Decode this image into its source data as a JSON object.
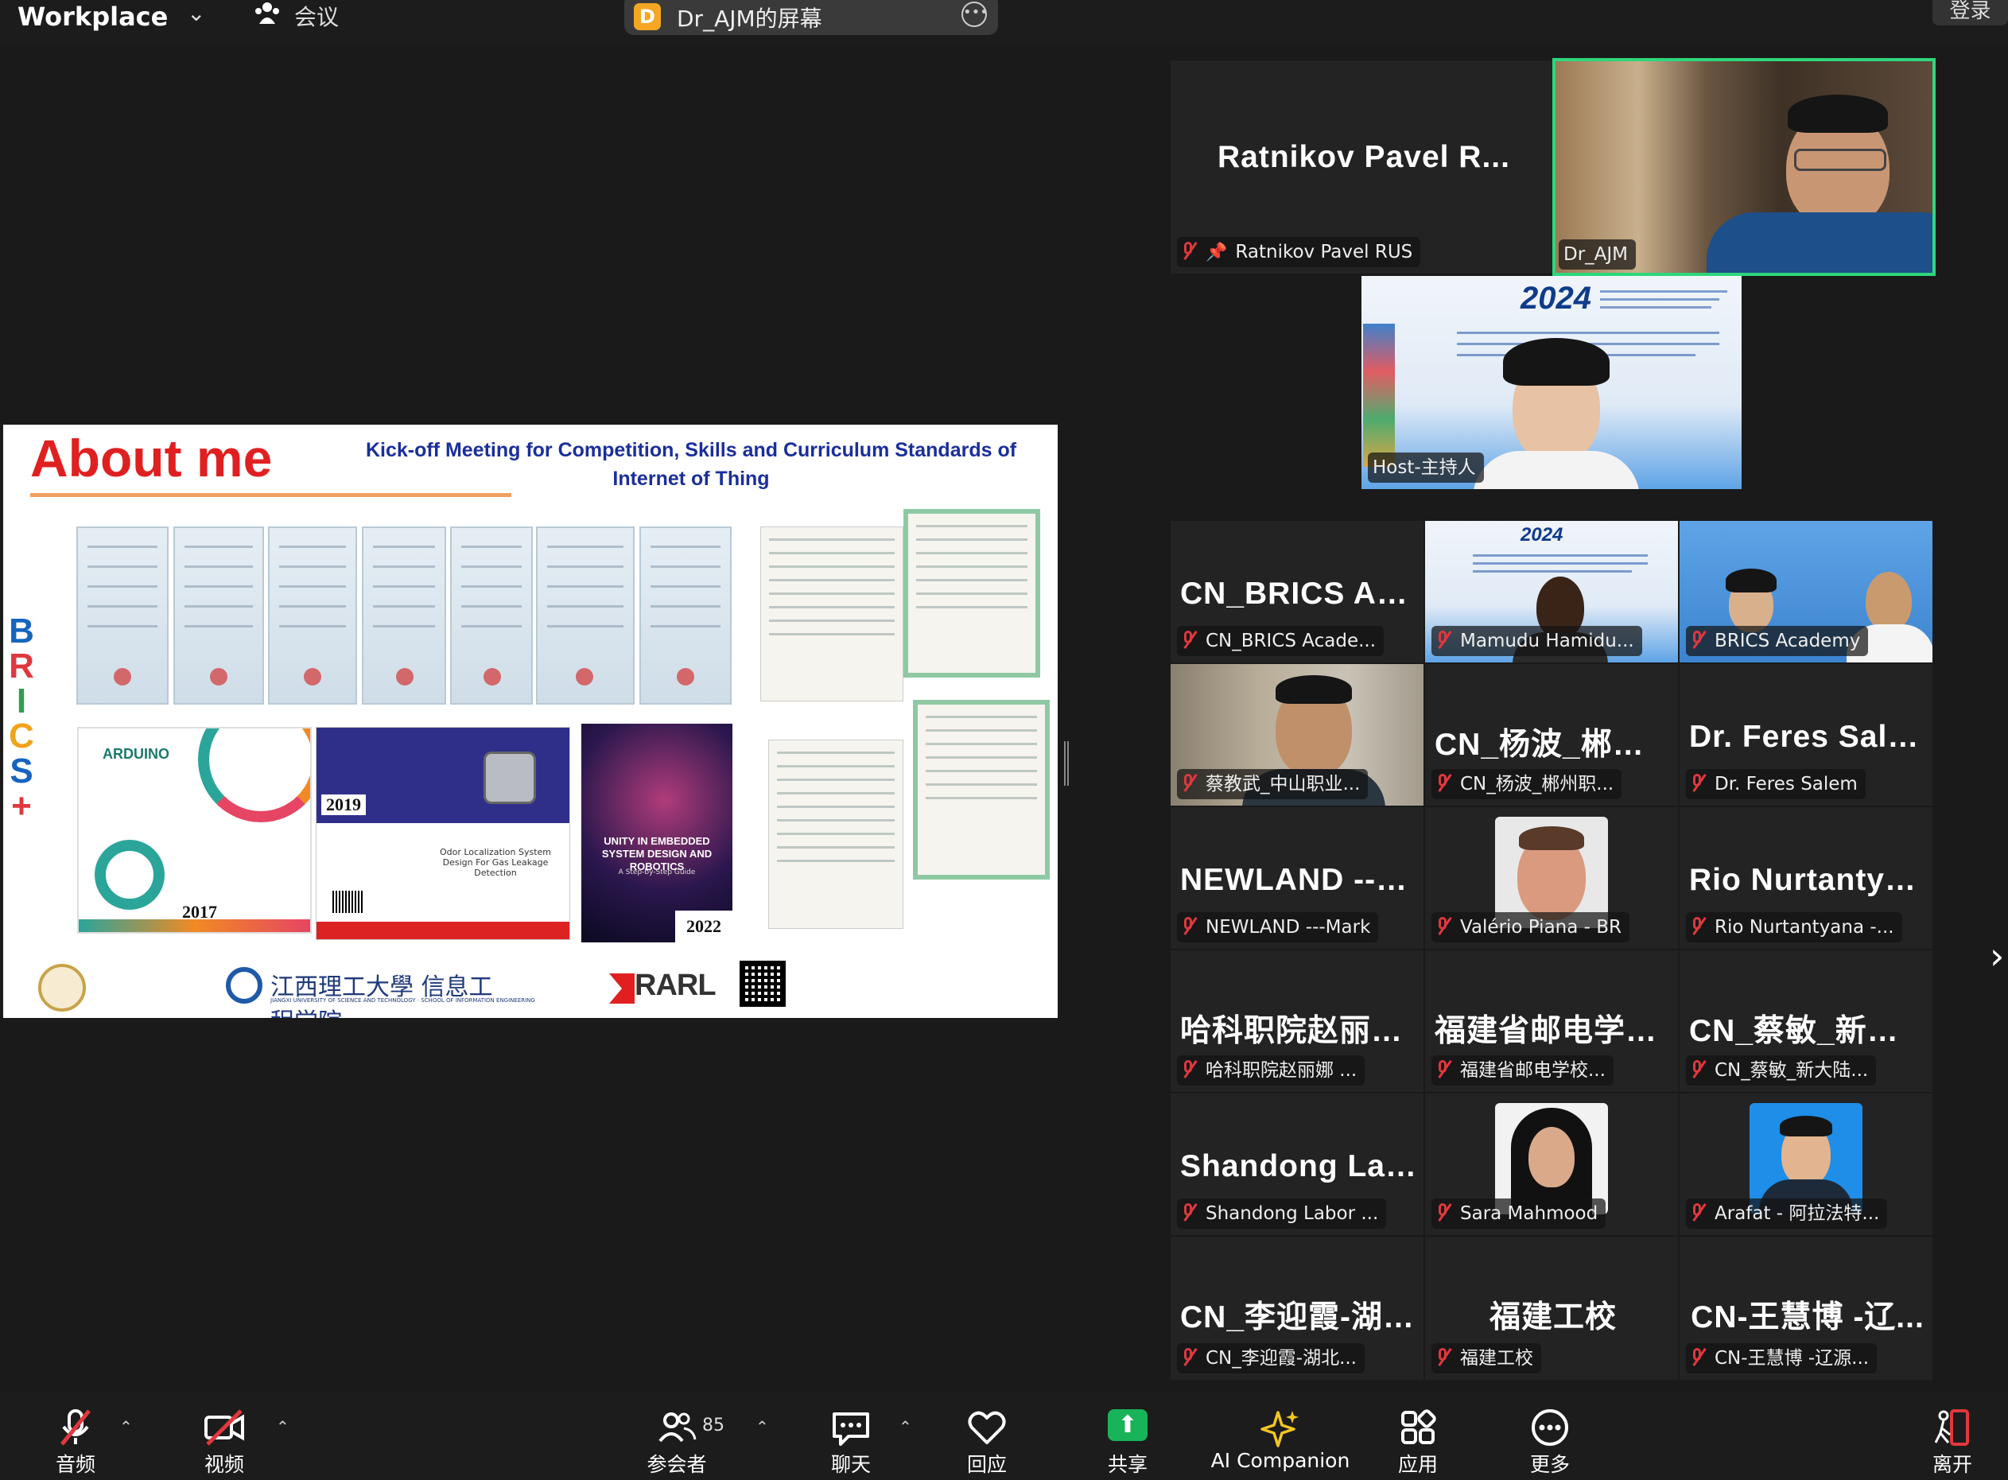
{
  "topbar": {
    "app_name": "Workplace",
    "meeting_label": "会议",
    "share_badge": "D",
    "share_title": "Dr_AJM的屏幕",
    "login": "登录"
  },
  "slide": {
    "heading": "About me",
    "subtitle": "Kick-off Meeting for Competition, Skills and Curriculum Standards of Internet of Thing",
    "brics_letters": [
      "B",
      "R",
      "I",
      "C",
      "S",
      "+"
    ],
    "book_arduino_year": "2017",
    "book_arduino_word": "ARDUINO",
    "book_odor_year": "2019",
    "book_odor_title": "Odor Localization System Design For Gas Leakage Detection",
    "book_unity_title": "UNITY IN EMBEDDED SYSTEM DESIGN AND ROBOTICS",
    "book_unity_sub": "A Step-by-Step Guide",
    "book_unity_year": "2022",
    "logo_jx_cn": "江西理工大學 信息工程学院",
    "logo_jx_en": "JIANGXI UNIVERSITY OF SCIENCE AND TECHNOLOGY · SCHOOL OF INFORMATION ENGINEERING",
    "logo_rarl": "RARL"
  },
  "speakers": {
    "ratnikov": {
      "name": "Ratnikov  Pavel  R...",
      "label": "Ratnikov Pavel RUS"
    },
    "ajm": {
      "label": "Dr_AJM"
    },
    "host": {
      "label": "Host-主持人",
      "poster_year": "2024"
    }
  },
  "gallery": [
    {
      "name": "CN_BRICS  Acad...",
      "label": "CN_BRICS Acade..."
    },
    {
      "name": "",
      "label": "Mamudu Hamidu..."
    },
    {
      "name": "",
      "label": "BRICS Academy"
    },
    {
      "name": "",
      "label": "蔡教武_中山职业..."
    },
    {
      "name": "CN_杨波_郴州职...",
      "label": "CN_杨波_郴州职..."
    },
    {
      "name": "Dr. Feres Salem",
      "label": "Dr. Feres Salem"
    },
    {
      "name": "NEWLAND  ---M...",
      "label": "NEWLAND ---Mark"
    },
    {
      "name": "",
      "label": "Valério Piana - BR"
    },
    {
      "name": "Rio  Nurtantyan...",
      "label": "Rio Nurtantyana -..."
    },
    {
      "name": "哈科职院赵丽娜...",
      "label": "哈科职院赵丽娜 ..."
    },
    {
      "name": "福建省邮电学校...",
      "label": "福建省邮电学校..."
    },
    {
      "name": "CN_蔡敏_新大陆...",
      "label": "CN_蔡敏_新大陆..."
    },
    {
      "name": "Shandong  Labor...",
      "label": "Shandong Labor ..."
    },
    {
      "name": "",
      "label": "Sara Mahmood"
    },
    {
      "name": "",
      "label": "Arafat - 阿拉法特..."
    },
    {
      "name": "CN_李迎霞-湖北...",
      "label": "CN_李迎霞-湖北..."
    },
    {
      "name": "福建工校",
      "label": "福建工校"
    },
    {
      "name": "CN-王慧博  -辽...",
      "label": "CN-王慧博 -辽源..."
    }
  ],
  "toolbar": {
    "audio": "音频",
    "video": "视频",
    "participants": "参会者",
    "participants_count": "85",
    "chat": "聊天",
    "react": "回应",
    "share": "共享",
    "ai": "AI Companion",
    "apps": "应用",
    "more": "更多",
    "leave": "离开"
  },
  "colors": {
    "active_speaker_border": "#2ed67b",
    "mute_red": "#e0383e",
    "share_green": "#19b35a",
    "heading_red": "#e02020",
    "subtitle_blue": "#1a2f9a",
    "share_badge": "#f5a623"
  },
  "icons": [
    "chevron-down-icon",
    "meeting-people-icon",
    "more-icon",
    "mic-muted-icon",
    "pin-icon",
    "camera-off-icon",
    "participants-icon",
    "chat-icon",
    "heart-icon",
    "share-up-icon",
    "sparkle-icon",
    "apps-icon",
    "more-dots-icon",
    "leave-icon",
    "chevron-right-icon"
  ]
}
